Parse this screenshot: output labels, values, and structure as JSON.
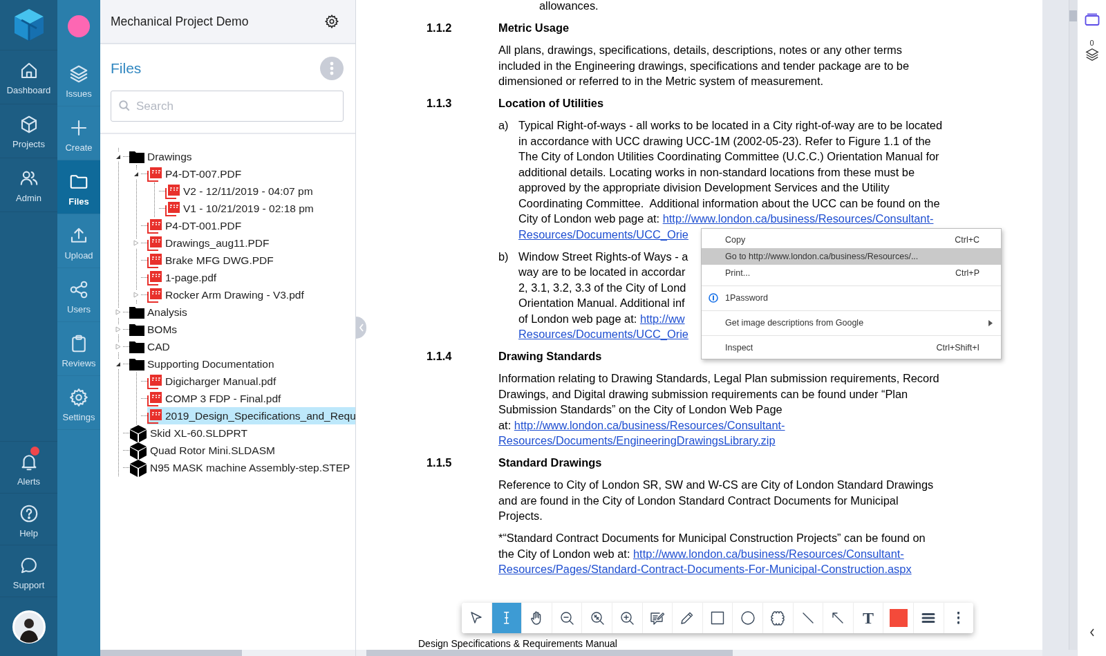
{
  "nav_primary": [
    {
      "label": "Dashboard",
      "kind": "dashboard",
      "badge": false
    },
    {
      "label": "Projects",
      "kind": "projects",
      "badge": false
    },
    {
      "label": "Admin",
      "kind": "admin",
      "badge": false
    }
  ],
  "nav_primary_bottom": [
    {
      "label": "Alerts",
      "kind": "alerts",
      "badge": true
    },
    {
      "label": "Help",
      "kind": "help",
      "badge": false
    },
    {
      "label": "Support",
      "kind": "support",
      "badge": false
    }
  ],
  "nav_secondary": [
    {
      "label": "Issues",
      "kind": "issues",
      "selected": false
    },
    {
      "label": "Create",
      "kind": "create",
      "selected": false
    },
    {
      "label": "Files",
      "kind": "files",
      "selected": true
    },
    {
      "label": "Upload",
      "kind": "upload",
      "selected": false
    },
    {
      "label": "Users",
      "kind": "users",
      "selected": false
    },
    {
      "label": "Reviews",
      "kind": "reviews",
      "selected": false
    },
    {
      "label": "Settings",
      "kind": "settings",
      "selected": false
    }
  ],
  "project_title": "Mechanical Project Demo",
  "files": {
    "title": "Files",
    "search": {
      "placeholder": "Search"
    },
    "tree": [
      {
        "label": "Drawings",
        "kind": "folder",
        "expanded": true,
        "selected": false,
        "children": [
          {
            "label": "P4-DT-007.PDF",
            "kind": "pdf",
            "expanded": true,
            "selected": false,
            "children": [
              {
                "label": "V2 - 12/11/2019 - 04:07 pm",
                "kind": "pdf",
                "selected": false
              },
              {
                "label": "V1 - 10/21/2019 - 02:18 pm",
                "kind": "pdf",
                "selected": false
              }
            ]
          },
          {
            "label": "P4-DT-001.PDF",
            "kind": "pdf",
            "selected": false
          },
          {
            "label": "Drawings_aug11.PDF",
            "kind": "pdf",
            "expanded": false,
            "selected": false
          },
          {
            "label": "Brake MFG DWG.PDF",
            "kind": "pdf",
            "selected": false
          },
          {
            "label": "1-page.pdf",
            "kind": "pdf",
            "selected": false
          },
          {
            "label": "Rocker Arm Drawing - V3.pdf",
            "kind": "pdf",
            "expanded": false,
            "selected": false
          }
        ]
      },
      {
        "label": "Analysis",
        "kind": "folder",
        "expanded": false,
        "selected": false
      },
      {
        "label": "BOMs",
        "kind": "folder",
        "expanded": false,
        "selected": false
      },
      {
        "label": "CAD",
        "kind": "folder",
        "expanded": false,
        "selected": false
      },
      {
        "label": "Supporting Documentation",
        "kind": "folder",
        "expanded": true,
        "selected": false,
        "children": [
          {
            "label": "Digicharger Manual.pdf",
            "kind": "pdf",
            "selected": false
          },
          {
            "label": "COMP 3 FDP - Final.pdf",
            "kind": "pdf",
            "selected": false
          },
          {
            "label": "2019_Design_Specifications_and_Requ",
            "kind": "pdf",
            "selected": true
          }
        ]
      },
      {
        "label": "Skid XL-60.SLDPRT",
        "kind": "model",
        "selected": false
      },
      {
        "label": "Quad Rotor Mini.SLDASM",
        "kind": "model",
        "selected": false
      },
      {
        "label": "N95 MASK machine Assembly-step.STEP",
        "kind": "model",
        "selected": false
      }
    ]
  },
  "document": {
    "blocks": [
      {
        "kind": "lead",
        "lines": [
          "allowances."
        ]
      },
      {
        "kind": "heading",
        "number": "1.1.2",
        "title": "Metric Usage"
      },
      {
        "kind": "para",
        "lines": [
          "All plans, drawings, specifications, details, descriptions, notes or any other terms",
          "included in the Engineering drawings, specifications and tender package are to be",
          "dimensioned or referred to in the Metric system of measurement."
        ]
      },
      {
        "kind": "heading",
        "number": "1.1.3",
        "title": "Location of Utilities"
      },
      {
        "kind": "item",
        "marker": "a)",
        "lines": [
          "Typical Right-of-ways - all works to be located in a City right-of-way are to be located",
          "in accordance with UCC drawing UCC-1M (2002-05-23). Refer to Figure 1.1 of the",
          "The City of London Utilities Coordinating Committee (U.C.C.) Orientation Manual for",
          "additional details. Locating works in non-standard locations from these must be",
          "approved by the appropriate division Development Services and the Utility",
          "Coordinating Committee.  Additional information about the UCC can be found on the",
          "City of London web page at:"
        ],
        "link_lines": [
          "http://www.london.ca/business/Resources/Consultant-",
          "Resources/Documents/UCC_Orie"
        ]
      },
      {
        "kind": "item",
        "marker": "b)",
        "lines": [
          "Window Street Rights-of Ways - a",
          "way are to be located in accordar",
          "2, 3.1, 3.2, 3.3 of the City of Lond",
          "Orientation Manual. Additional inf",
          "of London web page at:"
        ],
        "link_lines": [
          "http://ww",
          "Resources/Documents/UCC_Orie"
        ]
      },
      {
        "kind": "heading",
        "number": "1.1.4",
        "title": "Drawing Standards"
      },
      {
        "kind": "para",
        "lines": [
          "Information relating to Drawing Standards, Legal Plan submission requirements, Record",
          "Drawings, and Digital drawing submission requirements can be found under “Plan",
          "Submission Standards” on the City of London Web Page",
          "at:"
        ],
        "link_lines": [
          "http://www.london.ca/business/Resources/Consultant-",
          "Resources/Documents/EngineeringDrawingsLibrary.zip"
        ]
      },
      {
        "kind": "heading",
        "number": "1.1.5",
        "title": "Standard Drawings"
      },
      {
        "kind": "para",
        "lines": [
          "Reference to City of London SR, SW and W-CS are City of London Standard Drawings",
          "and are found in the City of London Standard Contract Documents for Municipal",
          "Projects."
        ]
      },
      {
        "kind": "para",
        "lines": [
          "*“Standard Contract Documents for Municipal Construction Projects” can be found on",
          "the City of London web at:"
        ],
        "link_lines": [
          "http://www.london.ca/business/Resources/Consultant-",
          "Resources/Pages/Standard-Contract-Documents-For-Municipal-Construction.aspx"
        ]
      }
    ],
    "footer": "Design Specifications & Requirements Manual"
  },
  "context_menu": [
    {
      "kind": "item",
      "label": "Copy",
      "shortcut": "Ctrl+C",
      "selected": false,
      "submenu": false
    },
    {
      "kind": "item",
      "label": "Go to http://www.london.ca/business/Resources/...",
      "selected": true,
      "submenu": false
    },
    {
      "kind": "item",
      "label": "Print...",
      "shortcut": "Ctrl+P",
      "selected": false,
      "submenu": false
    },
    {
      "kind": "separator"
    },
    {
      "kind": "icon-item",
      "label": "1Password",
      "selected": false,
      "submenu": false
    },
    {
      "kind": "separator"
    },
    {
      "kind": "item",
      "label": "Get image descriptions from Google",
      "selected": false,
      "submenu": true
    },
    {
      "kind": "separator"
    },
    {
      "kind": "item",
      "label": "Inspect",
      "shortcut": "Ctrl+Shift+I",
      "selected": false,
      "submenu": false
    }
  ],
  "toolbar": [
    {
      "kind": "select",
      "selected": false
    },
    {
      "kind": "text-select",
      "selected": true
    },
    {
      "kind": "pan",
      "selected": false
    },
    {
      "kind": "zoom-out",
      "selected": false
    },
    {
      "kind": "zoom-fit",
      "selected": false
    },
    {
      "kind": "zoom-in",
      "selected": false
    },
    {
      "kind": "note",
      "selected": false
    },
    {
      "kind": "pencil",
      "selected": false
    },
    {
      "kind": "rectangle",
      "selected": false
    },
    {
      "kind": "ellipse",
      "selected": false
    },
    {
      "kind": "cloud",
      "selected": false
    },
    {
      "kind": "line",
      "selected": false
    },
    {
      "kind": "arrow",
      "selected": false
    },
    {
      "kind": "text",
      "glyph": "T",
      "selected": false
    },
    {
      "kind": "color",
      "color": "#f44a3a",
      "selected": false
    },
    {
      "kind": "line-weight",
      "selected": false
    },
    {
      "kind": "more",
      "selected": false
    }
  ],
  "right_rail": {
    "count": "0"
  }
}
